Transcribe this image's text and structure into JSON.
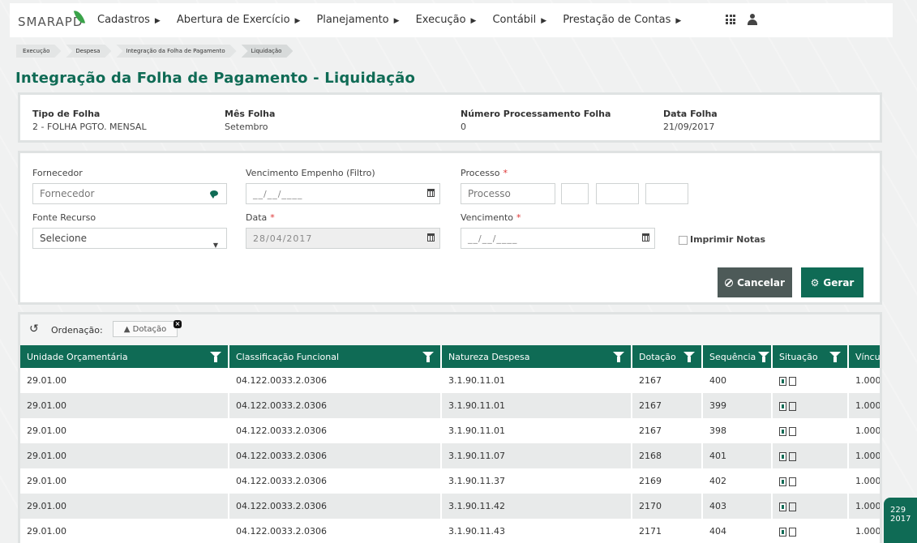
{
  "brand": {
    "name": "SMARAPD"
  },
  "menu": [
    {
      "label": "Cadastros"
    },
    {
      "label": "Abertura de Exercício"
    },
    {
      "label": "Planejamento"
    },
    {
      "label": "Execução"
    },
    {
      "label": "Contábil"
    },
    {
      "label": "Prestação de Contas"
    }
  ],
  "breadcrumb": [
    "Execução",
    "Despesa",
    "Integração da Folha de Pagamento",
    "Liquidação"
  ],
  "page_title": "Integração da Folha de Pagamento - Liquidação",
  "info": {
    "tipo_folha": {
      "label": "Tipo de Folha",
      "value": "2 - FOLHA PGTO. MENSAL"
    },
    "mes_folha": {
      "label": "Mês Folha",
      "value": "Setembro"
    },
    "numero_processamento": {
      "label": "Número Processamento Folha",
      "value": "0"
    },
    "data_folha": {
      "label": "Data Folha",
      "value": "21/09/2017"
    }
  },
  "form": {
    "fornecedor": {
      "label": "Fornecedor",
      "placeholder": "Fornecedor"
    },
    "vencimento_empenho": {
      "label": "Vencimento Empenho (Filtro)",
      "value": "__/__/____"
    },
    "processo": {
      "label": "Processo",
      "required": "*",
      "placeholder": "Processo"
    },
    "fonte_recurso": {
      "label": "Fonte Recurso",
      "value": "Selecione"
    },
    "data": {
      "label": "Data",
      "required": "*",
      "value": "28/04/2017"
    },
    "vencimento": {
      "label": "Vencimento",
      "required": "*",
      "value": "__/__/____"
    },
    "imprimir_notas": {
      "label": "Imprimir Notas",
      "checked": false
    },
    "cancel_label": "Cancelar",
    "gerar_label": "Gerar"
  },
  "grid": {
    "ordenacao_label": "Ordenação:",
    "ordenacao_chip": "▲ Dotação",
    "columns": [
      "Unidade Orçamentária",
      "Classificação Funcional",
      "Natureza Despesa",
      "Dotação",
      "Sequência",
      "Situação",
      "Víncu"
    ],
    "rows": [
      [
        "29.01.00",
        "04.122.0033.2.0306",
        "3.1.90.11.01",
        "2167",
        "400",
        "",
        "1.000"
      ],
      [
        "29.01.00",
        "04.122.0033.2.0306",
        "3.1.90.11.01",
        "2167",
        "399",
        "",
        "1.000"
      ],
      [
        "29.01.00",
        "04.122.0033.2.0306",
        "3.1.90.11.01",
        "2167",
        "398",
        "",
        "1.000"
      ],
      [
        "29.01.00",
        "04.122.0033.2.0306",
        "3.1.90.11.07",
        "2168",
        "401",
        "",
        "1.000"
      ],
      [
        "29.01.00",
        "04.122.0033.2.0306",
        "3.1.90.11.37",
        "2169",
        "402",
        "",
        "1.000"
      ],
      [
        "29.01.00",
        "04.122.0033.2.0306",
        "3.1.90.11.42",
        "2170",
        "403",
        "",
        "1.000"
      ],
      [
        "29.01.00",
        "04.122.0033.2.0306",
        "3.1.90.11.43",
        "2171",
        "404",
        "",
        "1.000"
      ]
    ]
  },
  "side_badge": {
    "line1": "229",
    "line2": "2017"
  },
  "colors": {
    "primary": "#0f6b55",
    "cancel": "#4d5a58",
    "background": "#f0f1f1"
  }
}
